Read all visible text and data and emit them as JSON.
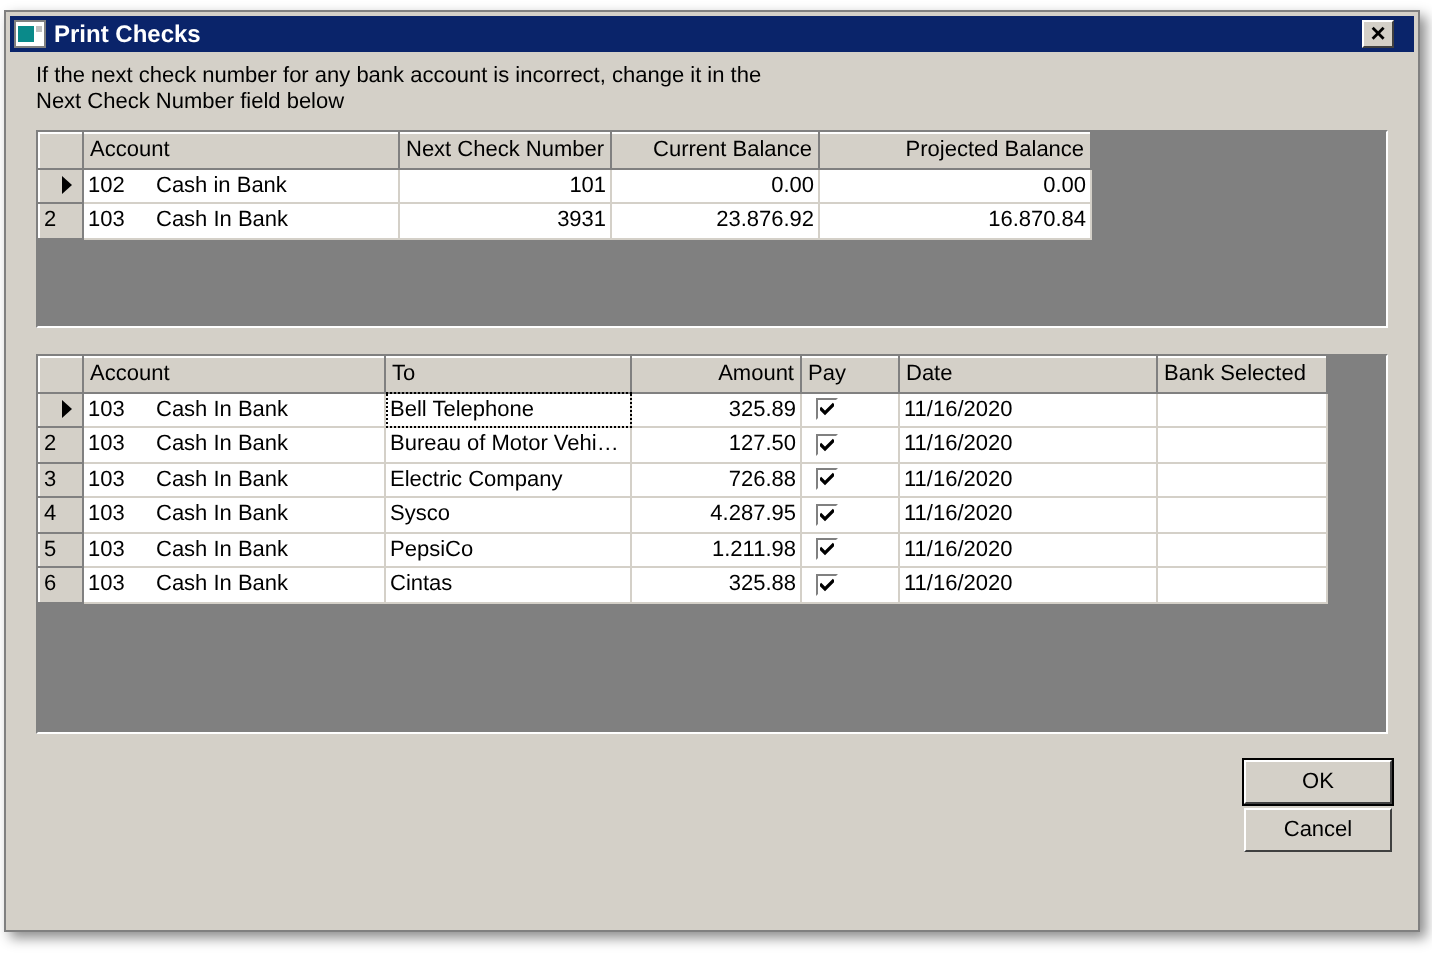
{
  "window": {
    "title": "Print Checks",
    "close_label": "×"
  },
  "instructions": "If the next check number for any bank account is incorrect, change it in the Next Check Number field below",
  "accounts_table": {
    "columns": [
      "Account",
      "Next Check Number",
      "Current Balance",
      "Projected Balance"
    ],
    "rows": [
      {
        "selected": true,
        "account_number": "102",
        "account_name": "Cash in Bank",
        "next_check_number": "101",
        "current_balance": "0.00",
        "projected_balance": "0.00"
      },
      {
        "selected": false,
        "row_number": "2",
        "account_number": "103",
        "account_name": "Cash In Bank",
        "next_check_number": "3931",
        "current_balance": "23.876.92",
        "projected_balance": "16.870.84"
      }
    ]
  },
  "checks_table": {
    "columns": [
      "Account",
      "To",
      "Amount",
      "Pay",
      "Date",
      "Bank Selected"
    ],
    "rows": [
      {
        "selected": true,
        "account_number": "103",
        "account_name": "Cash In Bank",
        "to": "Bell Telephone",
        "to_focused": true,
        "amount": "325.89",
        "pay": true,
        "date": "11/16/2020"
      },
      {
        "selected": false,
        "row_number": "2",
        "account_number": "103",
        "account_name": "Cash In Bank",
        "to": "Bureau of Motor Vehi…",
        "to_focused": false,
        "amount": "127.50",
        "pay": true,
        "date": "11/16/2020"
      },
      {
        "selected": false,
        "row_number": "3",
        "account_number": "103",
        "account_name": "Cash In Bank",
        "to": "Electric Company",
        "to_focused": false,
        "amount": "726.88",
        "pay": true,
        "date": "11/16/2020"
      },
      {
        "selected": false,
        "row_number": "4",
        "account_number": "103",
        "account_name": "Cash In Bank",
        "to": "Sysco",
        "to_focused": false,
        "amount": "4.287.95",
        "pay": true,
        "date": "11/16/2020"
      },
      {
        "selected": false,
        "row_number": "5",
        "account_number": "103",
        "account_name": "Cash In Bank",
        "to": "PepsiCo",
        "to_focused": false,
        "amount": "1.211.98",
        "pay": true,
        "date": "11/16/2020"
      },
      {
        "selected": false,
        "row_number": "6",
        "account_number": "103",
        "account_name": "Cash In Bank",
        "to": "Cintas",
        "to_focused": false,
        "amount": "325.88",
        "pay": true,
        "date": "11/16/2020"
      }
    ]
  },
  "buttons": [
    {
      "label": "OK",
      "default": true
    },
    {
      "label": "Cancel",
      "default": false
    }
  ]
}
